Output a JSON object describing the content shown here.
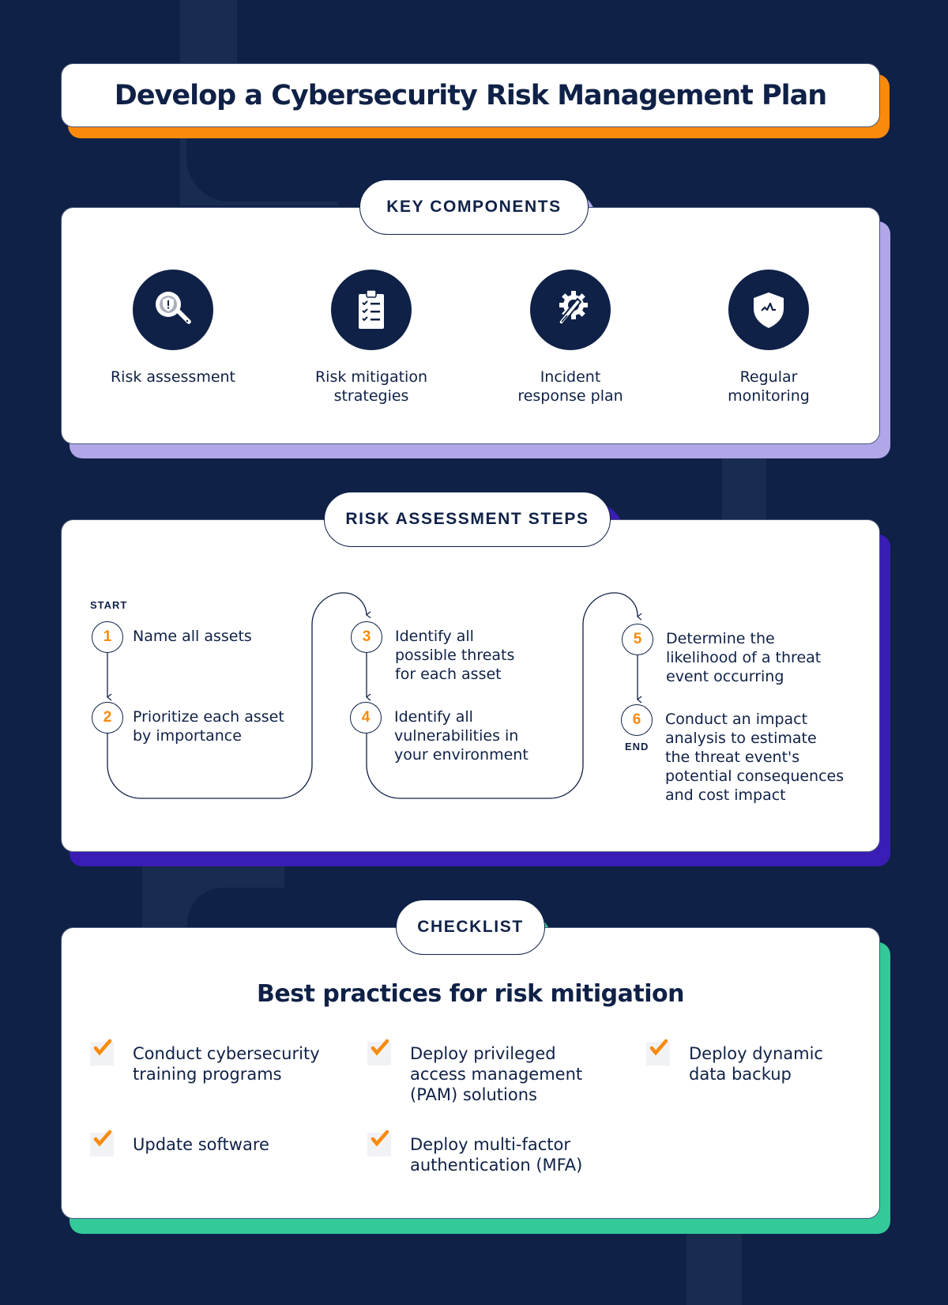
{
  "title": "Develop a Cybersecurity Risk Management Plan",
  "colors": {
    "background": "#0f2147",
    "navy": "#0f2147",
    "orange": "#f98a0c",
    "lavender": "#b0a6e8",
    "indigo": "#3a1db5",
    "green": "#33c999"
  },
  "key_components": {
    "heading": "KEY COMPONENTS",
    "items": [
      {
        "label_line1": "Risk assessment",
        "label_line2": "",
        "icon": "magnifier-shield-icon"
      },
      {
        "label_line1": "Risk mitigation",
        "label_line2": "strategies",
        "icon": "clipboard-checklist-icon"
      },
      {
        "label_line1": "Incident",
        "label_line2": "response plan",
        "icon": "gear-wrench-icon"
      },
      {
        "label_line1": "Regular",
        "label_line2": "monitoring",
        "icon": "shield-pulse-icon"
      }
    ]
  },
  "risk_steps": {
    "heading": "RISK ASSESSMENT STEPS",
    "start_label": "START",
    "end_label": "END",
    "steps": [
      {
        "number": "1",
        "lines": [
          "Name all assets"
        ]
      },
      {
        "number": "2",
        "lines": [
          "Prioritize each asset",
          "by importance"
        ]
      },
      {
        "number": "3",
        "lines": [
          "Identify all",
          "possible threats",
          "for each asset"
        ]
      },
      {
        "number": "4",
        "lines": [
          "Identify all",
          "vulnerabilities in",
          "your environment"
        ]
      },
      {
        "number": "5",
        "lines": [
          "Determine the",
          "likelihood of a threat",
          "event occurring"
        ]
      },
      {
        "number": "6",
        "lines": [
          "Conduct an impact",
          "analysis to estimate",
          "the threat event's",
          "potential consequences",
          "and cost impact"
        ]
      }
    ]
  },
  "checklist": {
    "heading": "CHECKLIST",
    "subheading": "Best practices for risk mitigation",
    "items": [
      {
        "lines": [
          "Conduct cybersecurity",
          "training programs"
        ],
        "checked": true
      },
      {
        "lines": [
          "Deploy privileged",
          "access management",
          "(PAM) solutions"
        ],
        "checked": true
      },
      {
        "lines": [
          "Deploy dynamic",
          "data backup"
        ],
        "checked": true
      },
      {
        "lines": [
          "Update software"
        ],
        "checked": true
      },
      {
        "lines": [
          "Deploy multi-factor",
          "authentication (MFA)"
        ],
        "checked": true
      }
    ]
  }
}
